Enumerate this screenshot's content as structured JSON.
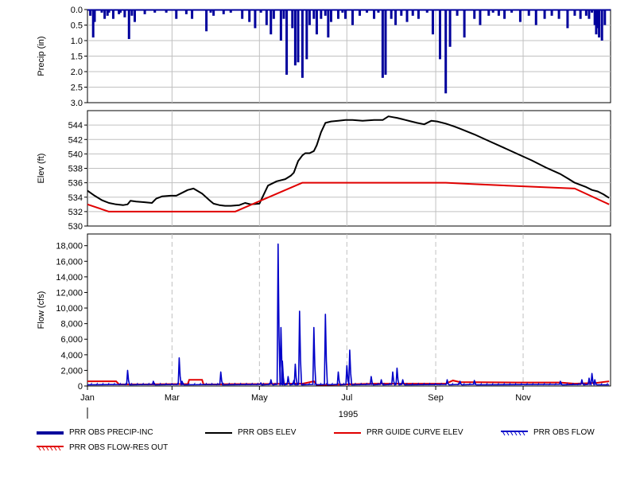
{
  "colors": {
    "precip": "#00009c",
    "elev": "#000000",
    "guide": "#e00000",
    "flow": "#0000c8",
    "res_out": "#e00000",
    "grid": "#c0c0c0",
    "frame": "#000000"
  },
  "chart_data": [
    {
      "type": "bar",
      "ylabel": "Precip (in)",
      "ylim": [
        0,
        3.0
      ],
      "y_inverted": true,
      "yticks": [
        "0.0",
        "0.5",
        "1.0",
        "1.5",
        "2.0",
        "2.5",
        "3.0"
      ],
      "series": [
        {
          "name": "PRR OBS PRECIP-INC",
          "x_day": [
            2,
            4,
            5,
            10,
            12,
            14,
            15,
            18,
            22,
            23,
            26,
            29,
            31,
            33,
            40,
            47,
            55,
            62,
            69,
            73,
            83,
            86,
            88,
            95,
            100,
            108,
            113,
            117,
            121,
            125,
            128,
            130,
            135,
            137,
            139,
            143,
            145,
            147,
            150,
            153,
            155,
            158,
            160,
            163,
            166,
            168,
            170,
            175,
            178,
            180,
            185,
            190,
            195,
            200,
            203,
            206,
            208,
            212,
            215,
            219,
            223,
            227,
            231,
            237,
            241,
            246,
            250,
            253,
            258,
            263,
            270,
            274,
            280,
            283,
            287,
            291,
            296,
            302,
            308,
            313,
            319,
            324,
            329,
            335,
            340,
            344,
            348,
            350,
            352,
            354,
            355,
            356,
            357,
            359,
            361
          ],
          "values": [
            0.2,
            0.9,
            0.4,
            0.1,
            0.3,
            0.2,
            0.1,
            0.3,
            0.15,
            0.1,
            0.25,
            0.95,
            0.2,
            0.4,
            0.15,
            0.1,
            0.1,
            0.3,
            0.15,
            0.3,
            0.7,
            0.1,
            0.2,
            0.15,
            0.1,
            0.3,
            0.4,
            0.6,
            0.1,
            0.5,
            0.8,
            0.3,
            1.0,
            0.3,
            2.1,
            0.6,
            1.8,
            1.7,
            2.2,
            1.6,
            0.5,
            0.3,
            0.8,
            0.3,
            0.2,
            0.9,
            0.4,
            0.3,
            0.1,
            0.3,
            0.5,
            0.2,
            0.1,
            0.3,
            0.1,
            2.2,
            2.1,
            0.3,
            0.5,
            0.2,
            0.4,
            0.2,
            0.3,
            0.1,
            0.8,
            1.6,
            2.7,
            1.2,
            0.2,
            0.9,
            0.3,
            0.5,
            0.2,
            0.1,
            0.2,
            0.3,
            0.1,
            0.4,
            0.2,
            0.5,
            0.3,
            0.2,
            0.3,
            0.6,
            0.2,
            0.3,
            0.2,
            0.3,
            0.1,
            0.5,
            0.8,
            0.6,
            0.9,
            1.0,
            0.5
          ]
        }
      ]
    },
    {
      "type": "line",
      "ylabel": "Elev (ft)",
      "ylim": [
        530,
        546
      ],
      "yticks": [
        "530",
        "532",
        "534",
        "536",
        "538",
        "540",
        "542",
        "544"
      ],
      "series": [
        {
          "name": "PRR OBS ELEV",
          "x_day": [
            0,
            5,
            10,
            15,
            20,
            25,
            28,
            30,
            34,
            40,
            45,
            48,
            52,
            58,
            62,
            65,
            70,
            74,
            80,
            85,
            88,
            92,
            96,
            100,
            106,
            110,
            114,
            120,
            126,
            132,
            138,
            142,
            144,
            147,
            150,
            152,
            155,
            158,
            160,
            163,
            166,
            170,
            175,
            180,
            185,
            192,
            200,
            206,
            210,
            213,
            216,
            220,
            226,
            230,
            235,
            240,
            244,
            250,
            256,
            260,
            270,
            280,
            290,
            300,
            310,
            320,
            330,
            336,
            340,
            344,
            348,
            352,
            356,
            360,
            364
          ],
          "values": [
            534.9,
            534.2,
            533.6,
            533.2,
            533.0,
            532.9,
            533.0,
            533.5,
            533.4,
            533.3,
            533.2,
            533.8,
            534.1,
            534.2,
            534.2,
            534.5,
            535.0,
            535.2,
            534.5,
            533.6,
            533.1,
            532.9,
            532.8,
            532.8,
            532.9,
            533.2,
            533.0,
            533.1,
            535.6,
            536.2,
            536.5,
            537.0,
            537.4,
            539.0,
            539.8,
            540.1,
            540.1,
            540.4,
            541.2,
            543.0,
            544.3,
            544.5,
            544.6,
            544.7,
            544.7,
            544.6,
            544.7,
            544.7,
            545.2,
            545.1,
            545.0,
            544.8,
            544.5,
            544.3,
            544.1,
            544.6,
            544.5,
            544.2,
            543.8,
            543.5,
            542.7,
            541.8,
            540.9,
            540.0,
            539.1,
            538.1,
            537.2,
            536.5,
            536.0,
            535.7,
            535.4,
            535.0,
            534.8,
            534.4,
            533.9
          ]
        },
        {
          "name": "PRR GUIDE CURVE ELEV",
          "x_day": [
            0,
            15,
            60,
            103,
            150,
            250,
            270,
            340,
            364
          ],
          "values": [
            533.0,
            532.0,
            532.0,
            532.0,
            536.0,
            536.0,
            535.8,
            535.2,
            533.0
          ]
        }
      ]
    },
    {
      "type": "line",
      "ylabel": "Flow (cfs)",
      "xlabel": "1995",
      "ylim": [
        0,
        19500
      ],
      "yticks": [
        "0",
        "2,000",
        "4,000",
        "6,000",
        "8,000",
        "10,000",
        "12,000",
        "14,000",
        "16,000",
        "18,000"
      ],
      "x_ticks": [
        "Jan",
        "Mar",
        "May",
        "Jul",
        "Sep",
        "Nov"
      ],
      "x_tick_days": [
        0,
        59,
        120,
        181,
        243,
        304
      ],
      "series": [
        {
          "name": "PRR OBS FLOW",
          "peaks_day": [
            28,
            46,
            64,
            66,
            93,
            121,
            128,
            133,
            135,
            136,
            140,
            144,
            145,
            148,
            158,
            166,
            175,
            181,
            183,
            198,
            205,
            213,
            216,
            220,
            251,
            260,
            270,
            330,
            345,
            350,
            352,
            354
          ],
          "peaks_cfs": [
            2000,
            600,
            3600,
            600,
            1800,
            400,
            800,
            18200,
            7500,
            3200,
            1200,
            700,
            2800,
            9600,
            7500,
            9200,
            1800,
            2600,
            4600,
            1200,
            800,
            1800,
            2300,
            800,
            800,
            600,
            700,
            600,
            800,
            1000,
            1600,
            800
          ]
        },
        {
          "name": "PRR OBS FLOW-RES OUT",
          "x_day": [
            0,
            20,
            22,
            40,
            60,
            70,
            71,
            80,
            81,
            90,
            100,
            120,
            140,
            150,
            158,
            160,
            170,
            200,
            230,
            250,
            255,
            260,
            300,
            330,
            340,
            355,
            364
          ],
          "values": [
            600,
            600,
            200,
            200,
            250,
            250,
            800,
            800,
            200,
            200,
            250,
            250,
            300,
            300,
            600,
            150,
            150,
            300,
            300,
            300,
            700,
            500,
            450,
            450,
            300,
            400,
            600
          ]
        }
      ]
    }
  ],
  "legend": {
    "items": [
      {
        "label": "PRR OBS PRECIP-INC"
      },
      {
        "label": "PRR OBS ELEV"
      },
      {
        "label": "PRR GUIDE CURVE ELEV"
      },
      {
        "label": "PRR OBS FLOW"
      },
      {
        "label": "PRR OBS FLOW-RES OUT"
      }
    ]
  }
}
